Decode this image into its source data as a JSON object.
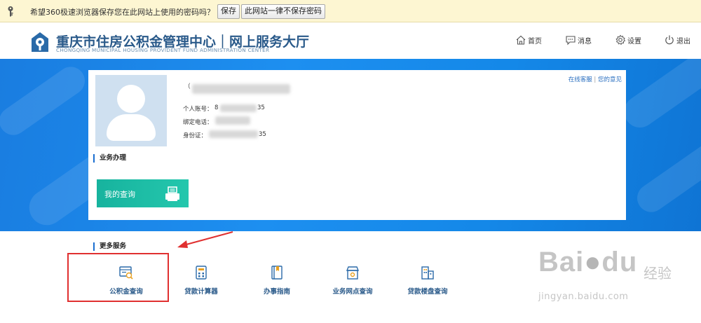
{
  "password_bar": {
    "message": "希望360极速浏览器保存您在此网站上使用的密码吗？",
    "save_label": "保存",
    "never_label": "此网站一律不保存密码"
  },
  "header": {
    "title_cn": "重庆市住房公积金管理中心｜网上服务大厅",
    "title_en": "CHONGQING MUNICIPAL HOUSING PROVIDENT FUND ADMINISTRATION CENTER",
    "nav": [
      {
        "label": "首页",
        "icon": "home-icon"
      },
      {
        "label": "消息",
        "icon": "message-icon"
      },
      {
        "label": "设置",
        "icon": "gear-icon"
      },
      {
        "label": "退出",
        "icon": "power-icon"
      }
    ]
  },
  "profile": {
    "name_masked": "（",
    "account_label": "个人账号：",
    "account_prefix": "8",
    "account_suffix": "35",
    "phone_label": "绑定电话：",
    "id_label": "身份证：",
    "id_suffix": "35",
    "links": {
      "service": "在线客服",
      "separator": "|",
      "feedback": "您的意见"
    }
  },
  "business": {
    "title": "业务办理",
    "query_button": "我的查询"
  },
  "more_services": {
    "title": "更多服务",
    "items": [
      {
        "label": "公积金查询",
        "icon": "fund-query-icon"
      },
      {
        "label": "贷款计算器",
        "icon": "calculator-icon"
      },
      {
        "label": "办事指南",
        "icon": "guide-book-icon"
      },
      {
        "label": "业务网点查询",
        "icon": "branch-store-icon"
      },
      {
        "label": "贷款楼盘查询",
        "icon": "building-icon"
      }
    ]
  },
  "watermark": {
    "brand": "Bai",
    "brand2": "du",
    "cn": "经验",
    "url": "jingyan.baidu.com"
  },
  "colors": {
    "banner": "#1d8ff0",
    "brand_blue": "#2a5a8a",
    "query_button": "#1fbda5",
    "highlight": "#e03030"
  }
}
